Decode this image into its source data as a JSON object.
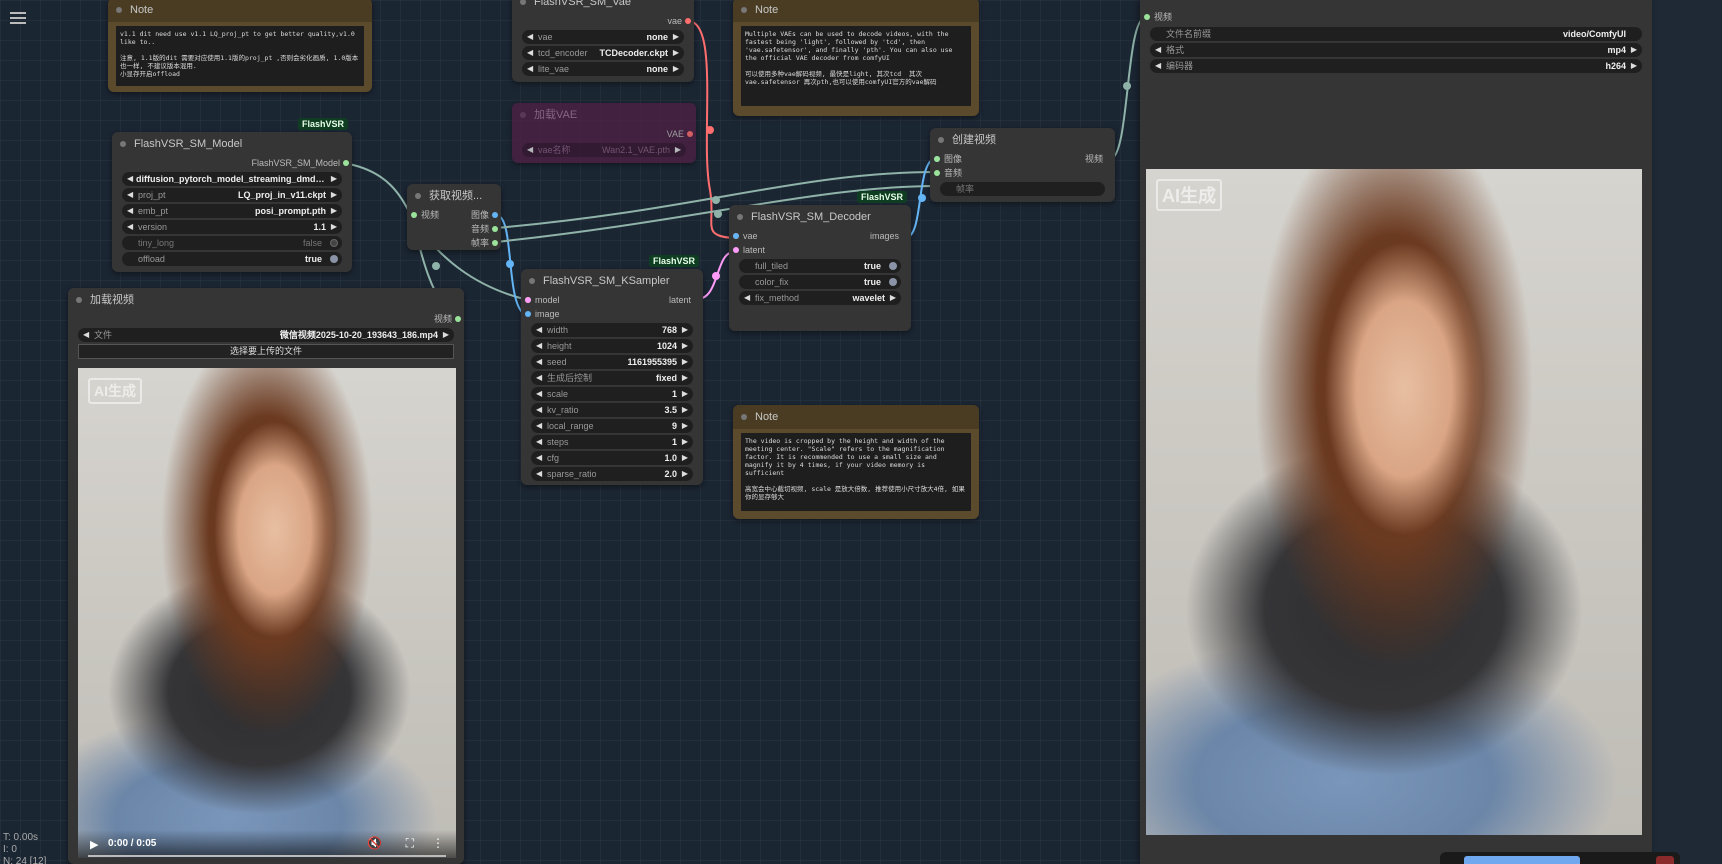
{
  "colors": {
    "canvas": "#1b2633",
    "node": "#353535",
    "note": "#5b4a2b",
    "vae_wire": "#ff6e6e",
    "image_wire": "#64b5f6",
    "latent_wire": "#ff9cf9",
    "model_wire": "#b39ddb",
    "generic_wire": "#8fb3a8",
    "badge": "#0f3d22"
  },
  "note1": {
    "title": "Note",
    "text": "v1.1 dit need use v1.1 LQ_proj_pt to get better quality,v1.0 like to..\n\n注意, 1.1版的dit 需要对应使用1.1版的proj_pt ,否则会劣化画质, 1.0版本也一样, 不建议版本混用.\n小显存开启offload"
  },
  "vae_loader": {
    "title": "FlashVSR_SM_Vae",
    "output": "vae",
    "widgets": [
      {
        "label": "vae",
        "value": "none"
      },
      {
        "label": "tcd_encoder",
        "value": "TCDecoder.ckpt"
      },
      {
        "label": "lite_vae",
        "value": "none"
      }
    ]
  },
  "note2": {
    "title": "Note",
    "text": "Multiple VAEs can be used to decode videos, with the fastest being 'light', followed by 'tcd', then 'vae.safetensor', and finally 'pth'. You can also use the official VAE decoder from comfyUI\n\n可以使用多种vae解码视频, 最快是light, 其次tcd  其次vae.safetensor 再次pth,也可以使用comfyUI官方的vae解码"
  },
  "load_vae": {
    "title": "加载VAE",
    "output": "VAE",
    "widget_label": "vae名称",
    "widget_value": "Wan2.1_VAE.pth"
  },
  "model_node": {
    "badge": "FlashVSR",
    "title": "FlashVSR_SM_Model",
    "output": "FlashVSR_SM_Model",
    "widgets": [
      {
        "label": "",
        "value": "diffusion_pytorch_model_streaming_dmd_v11.s ..."
      },
      {
        "label": "proj_pt",
        "value": "LQ_proj_in_v11.ckpt"
      },
      {
        "label": "emb_pt",
        "value": "posi_prompt.pth"
      },
      {
        "label": "version",
        "value": "1.1"
      }
    ],
    "toggles": [
      {
        "label": "tiny_long",
        "value": "false",
        "on": false
      },
      {
        "label": "offload",
        "value": "true",
        "on": true
      }
    ]
  },
  "get_video": {
    "title": "获取视频...",
    "input": "视频",
    "outputs": [
      "图像",
      "音频",
      "帧率"
    ]
  },
  "load_video": {
    "title": "加载视频",
    "output": "视频",
    "file_label": "文件",
    "file_value": "微信视频2025-10-20_193643_186.mp4",
    "upload_label": "选择要上传的文件",
    "watermark": "AI生成",
    "time": "0:00 / 0:05"
  },
  "ksampler": {
    "badge": "FlashVSR",
    "title": "FlashVSR_SM_KSampler",
    "inputs": [
      "model",
      "image"
    ],
    "output": "latent",
    "widgets": [
      {
        "label": "width",
        "value": "768"
      },
      {
        "label": "height",
        "value": "1024"
      },
      {
        "label": "seed",
        "value": "1161955395"
      },
      {
        "label": "生成后控制",
        "value": "fixed"
      },
      {
        "label": "scale",
        "value": "1"
      },
      {
        "label": "kv_ratio",
        "value": "3.5"
      },
      {
        "label": "local_range",
        "value": "9"
      },
      {
        "label": "steps",
        "value": "1"
      },
      {
        "label": "cfg",
        "value": "1.0"
      },
      {
        "label": "sparse_ratio",
        "value": "2.0"
      }
    ]
  },
  "decoder": {
    "badge": "FlashVSR",
    "title": "FlashVSR_SM_Decoder",
    "inputs": [
      "vae",
      "latent"
    ],
    "output": "images",
    "toggles": [
      {
        "label": "full_tiled",
        "value": "true"
      },
      {
        "label": "color_fix",
        "value": "true"
      }
    ],
    "widget": {
      "label": "fix_method",
      "value": "wavelet"
    }
  },
  "create_video": {
    "title": "创建视频",
    "inputs": [
      "图像",
      "音频",
      "帧率"
    ],
    "output": "视频"
  },
  "note3": {
    "title": "Note",
    "text": "The video is cropped by the height and width of the meeting center. \"Scale\" refers to the magnification factor. It is recommended to use a small size and magnify it by 4 times, if your video memory is sufficient\n\n高宽会中心截切视频, scale 是放大倍数, 推荐使用小尺寸放大4倍, 如果你的显存够大"
  },
  "save_video": {
    "input": "视频",
    "widgets": [
      {
        "label": "文件名前缀",
        "value": "video/ComfyUI"
      },
      {
        "label": "格式",
        "value": "mp4"
      },
      {
        "label": "编码器",
        "value": "h264"
      }
    ],
    "watermark": "AI生成"
  },
  "stats": {
    "time": "T: 0.00s",
    "i": "I: 0",
    "n": "N: 24 [12]"
  }
}
